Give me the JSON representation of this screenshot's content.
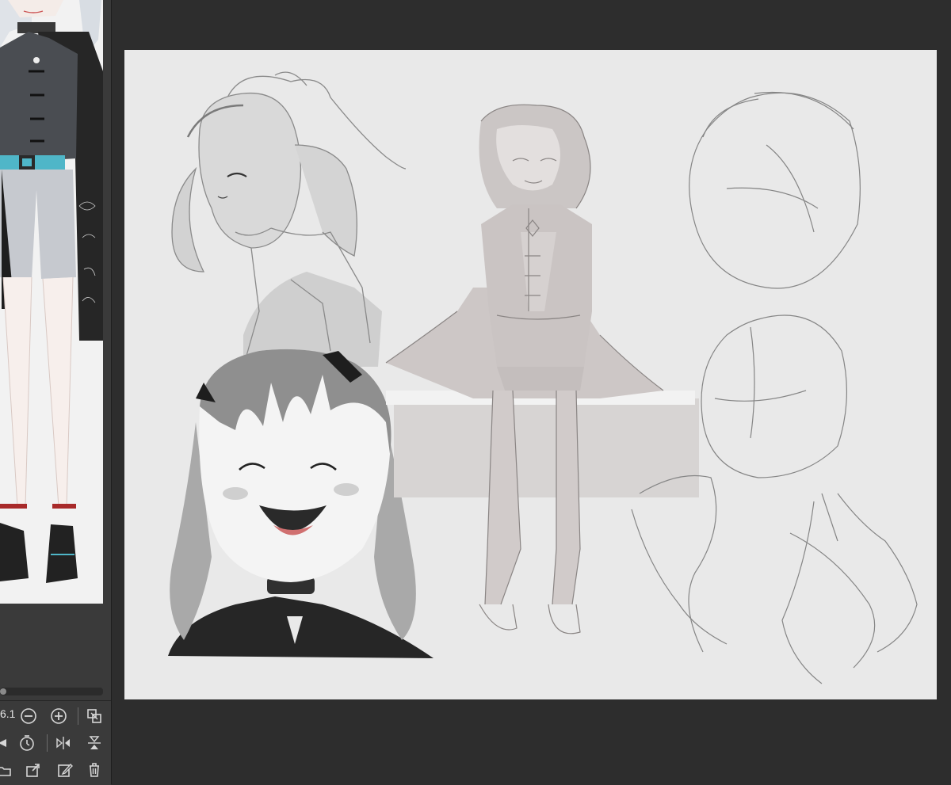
{
  "navigator": {
    "zoom_value": "6.1",
    "toolbar": [
      {
        "name": "zoom-out-icon"
      },
      {
        "name": "zoom-in-icon"
      },
      {
        "name": "fit-to-screen-icon"
      },
      {
        "name": "rotate-icon"
      },
      {
        "name": "reset-rotation-icon"
      },
      {
        "name": "flip-horizontal-icon"
      },
      {
        "name": "flip-vertical-icon"
      },
      {
        "name": "open-folder-icon"
      },
      {
        "name": "export-icon"
      },
      {
        "name": "edit-icon"
      },
      {
        "name": "trash-icon"
      }
    ]
  },
  "colors": {
    "app_background": "#2d2d2d",
    "panel_background": "#3a3a3a",
    "canvas_paper": "#e9e9e9",
    "sketch_stroke": "#7a7a7a",
    "belt_accent": "#4fb6c8",
    "ankle_ribbon": "#a82a2a"
  }
}
